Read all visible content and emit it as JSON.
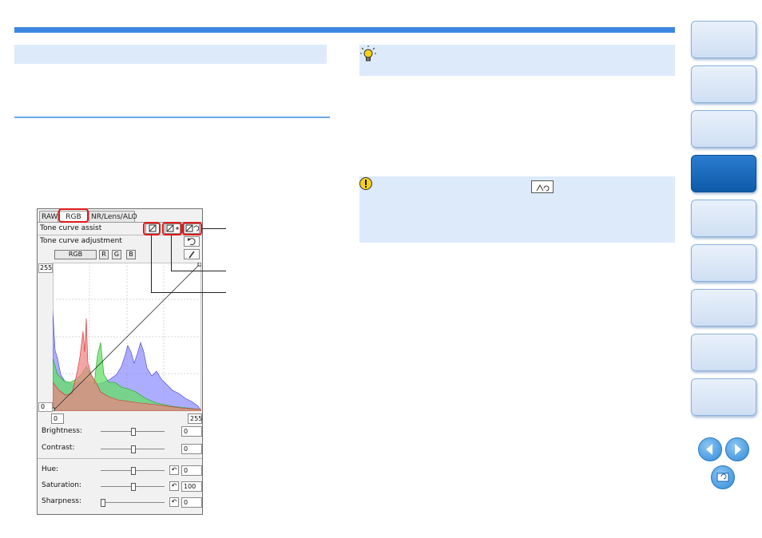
{
  "panel": {
    "tabs": [
      "RAW",
      "RGB",
      "NR/Lens/ALO"
    ],
    "active_tab": "RGB",
    "tone_curve_assist_label": "Tone curve assist",
    "tone_curve_adjustment_label": "Tone curve adjustment",
    "channel_buttons": [
      "RGB",
      "R",
      "G",
      "B"
    ],
    "axis": {
      "y_max": "255",
      "y_min": "0",
      "x_min_value": "0",
      "x_max_value": "255"
    },
    "sliders": [
      {
        "label": "Brightness:",
        "value": "0",
        "position": 0.5
      },
      {
        "label": "Contrast:",
        "value": "0",
        "position": 0.5
      },
      {
        "label": "Hue:",
        "value": "0",
        "position": 0.5
      },
      {
        "label": "Saturation:",
        "value": "100",
        "position": 0.5
      },
      {
        "label": "Sharpness:",
        "value": "0",
        "position": 0.0
      }
    ]
  },
  "colors": {
    "accent": "#3d86e0",
    "callout_bg": "#ddeafa",
    "active_nav_tab": "#1568bd",
    "highlight": "#e01919",
    "histogram_red": "#f08080",
    "histogram_green": "#66e066",
    "histogram_blue": "#8a8aff"
  },
  "icons": [
    "lightbulb-icon",
    "warning-icon",
    "curve-reset-icon",
    "prev-page-icon",
    "next-page-icon",
    "return-icon"
  ]
}
